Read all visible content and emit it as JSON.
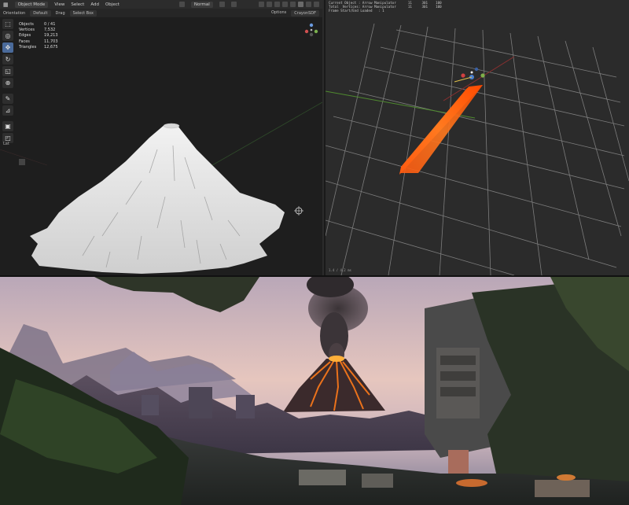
{
  "left_viewport": {
    "header": {
      "mode": "Object Mode",
      "menus": [
        "View",
        "Select",
        "Add",
        "Object"
      ],
      "shading": "Normal"
    },
    "subheader": {
      "orientation_label": "Orientation",
      "orientation_value": "Default",
      "drag_label": "Drag",
      "drag_value": "Select Box",
      "options": "Options",
      "extra": "CrayonSDF"
    },
    "stats": [
      {
        "key": "Objects",
        "value": "0 / 41"
      },
      {
        "key": "Vertices",
        "value": "7,532"
      },
      {
        "key": "Edges",
        "value": "19,213"
      },
      {
        "key": "Faces",
        "value": "11,703"
      },
      {
        "key": "Triangles",
        "value": "12,675"
      }
    ],
    "side_label": "Lat",
    "tool_icons": [
      "select-box-icon",
      "cursor-icon",
      "move-icon",
      "rotate-icon",
      "scale-icon",
      "transform-icon",
      "annotate-icon",
      "measure-icon",
      "add-cube-icon",
      "extrude-icon"
    ]
  },
  "right_viewport": {
    "log_lines": [
      "Current Object : Arrow Manipulator      11     301    100",
      "Total  Vertices: Arrow Manipulator      11     301    100",
      "Frame Start/End Loaded   : 1"
    ],
    "status": "1.4 / 4.2 ms"
  },
  "colors": {
    "blender_bg": "#1e1e1e",
    "grid_bg": "#2b2b2b",
    "lava": "#ff6a1a",
    "mesh_white": "#e6e6e6"
  }
}
